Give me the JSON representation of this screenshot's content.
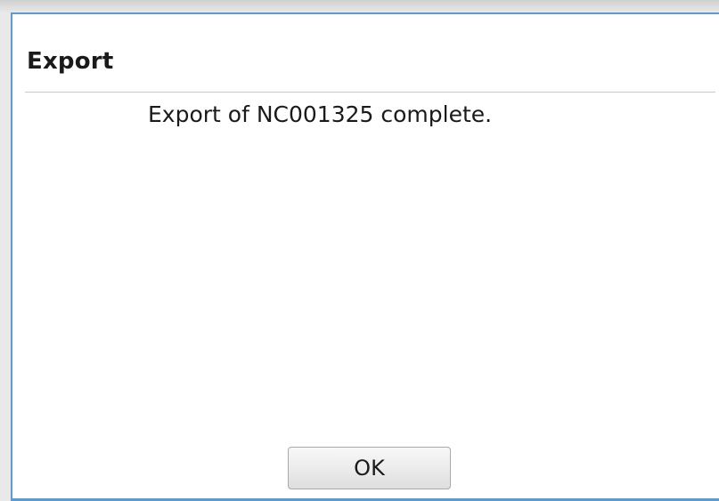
{
  "dialog": {
    "title": "Export",
    "message": "Export of NC001325 complete.",
    "ok_label": "OK"
  },
  "colors": {
    "accent_border": "#5b9bd5",
    "background": "#ffffff",
    "text": "#1a1a1a"
  }
}
